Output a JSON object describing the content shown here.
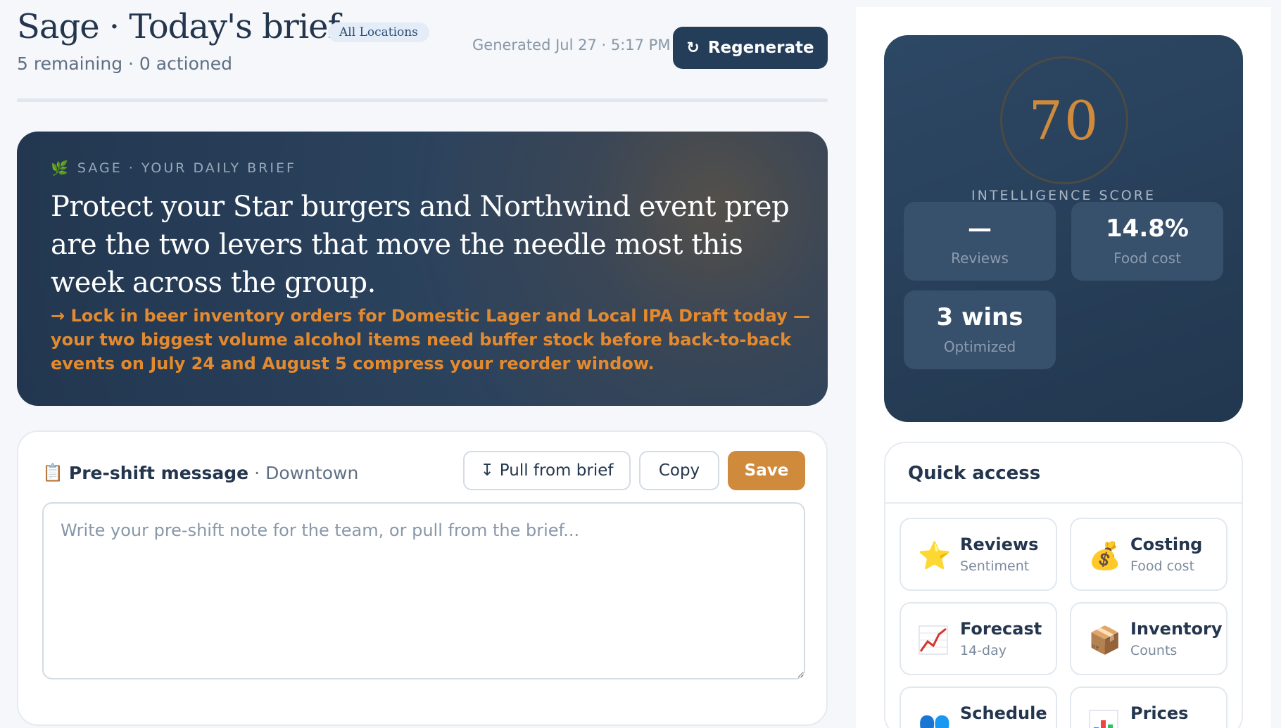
{
  "header": {
    "title": "Sage · Today's brief",
    "location_badge": "All Locations",
    "subtitle": "5 remaining · 0 actioned",
    "generated": "Generated Jul 27 · 5:17 PM",
    "regenerate_label": "Regenerate",
    "regenerate_icon": "refresh-icon"
  },
  "brief": {
    "kicker": "SAGE · YOUR DAILY BRIEF",
    "kicker_icon": "leaf-icon",
    "headline": "Protect your Star burgers and Northwind event prep are the two levers that move the needle most this week across the group.",
    "action": "→ Lock in beer inventory orders for Domestic Lager and Local IPA Draft today — your two biggest volume alcohol items need buffer stock before back-to-back events on July 24 and August 5 compress your reorder window."
  },
  "preshift": {
    "icon": "clipboard-icon",
    "title": "Pre-shift message",
    "separator": "·",
    "location": "Downtown",
    "pull_label": "Pull from brief",
    "pull_icon_glyph": "↧",
    "copy_label": "Copy",
    "save_label": "Save",
    "textarea_value": "",
    "textarea_placeholder": "Write your pre-shift note for the team, or pull from the brief..."
  },
  "score": {
    "value": "70",
    "label": "INTELLIGENCE SCORE",
    "stats": [
      {
        "value": "—",
        "label": "Reviews"
      },
      {
        "value": "14.8%",
        "label": "Food cost"
      },
      {
        "value": "3 wins",
        "label": "Optimized"
      }
    ]
  },
  "quick_access": {
    "title": "Quick access",
    "items": [
      {
        "name": "Reviews",
        "sub": "Sentiment",
        "icon": "star-icon",
        "glyph": "⭐"
      },
      {
        "name": "Costing",
        "sub": "Food cost",
        "icon": "money-bag-icon",
        "glyph": "💰"
      },
      {
        "name": "Forecast",
        "sub": "14-day",
        "icon": "trend-chart-icon",
        "glyph": ""
      },
      {
        "name": "Inventory",
        "sub": "Counts",
        "icon": "package-icon",
        "glyph": "📦"
      },
      {
        "name": "Schedule",
        "sub": "",
        "icon": "people-icon",
        "glyph": "👥"
      },
      {
        "name": "Prices",
        "sub": "",
        "icon": "bar-chart-icon",
        "glyph": ""
      }
    ]
  },
  "colors": {
    "navy": "#243e5a",
    "accent_orange": "#d08a3c",
    "action_orange": "#e48a2e",
    "background": "#f5f7fa"
  }
}
